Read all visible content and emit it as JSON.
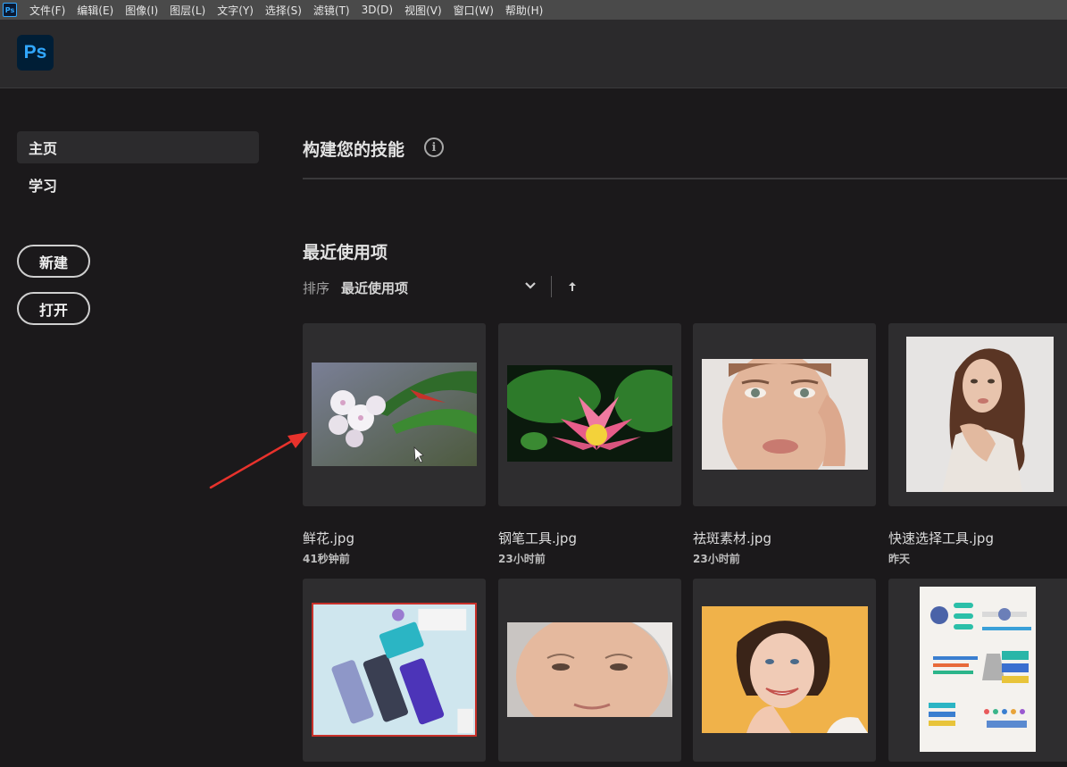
{
  "menubar": {
    "app_icon": "Ps",
    "items": [
      "文件(F)",
      "编辑(E)",
      "图像(I)",
      "图层(L)",
      "文字(Y)",
      "选择(S)",
      "滤镜(T)",
      "3D(D)",
      "视图(V)",
      "窗口(W)",
      "帮助(H)"
    ]
  },
  "header": {
    "logo": "Ps"
  },
  "sidebar": {
    "nav": [
      "主页",
      "学习"
    ],
    "new_button": "新建",
    "open_button": "打开"
  },
  "main": {
    "skills_title": "构建您的技能",
    "info_icon": "i",
    "recent_title": "最近使用项",
    "sort_label": "排序",
    "sort_value": "最近使用项"
  },
  "recent_files": [
    {
      "name": "鲜花.jpg",
      "time": "41秒钟前"
    },
    {
      "name": "钢笔工具.jpg",
      "time": "23小时前"
    },
    {
      "name": "祛斑素材.jpg",
      "time": "23小时前"
    },
    {
      "name": "快速选择工具.jpg",
      "time": "昨天"
    }
  ],
  "colors": {
    "ps_blue": "#31a8ff",
    "ps_dark": "#001e36",
    "annotation_red": "#e8322c"
  }
}
